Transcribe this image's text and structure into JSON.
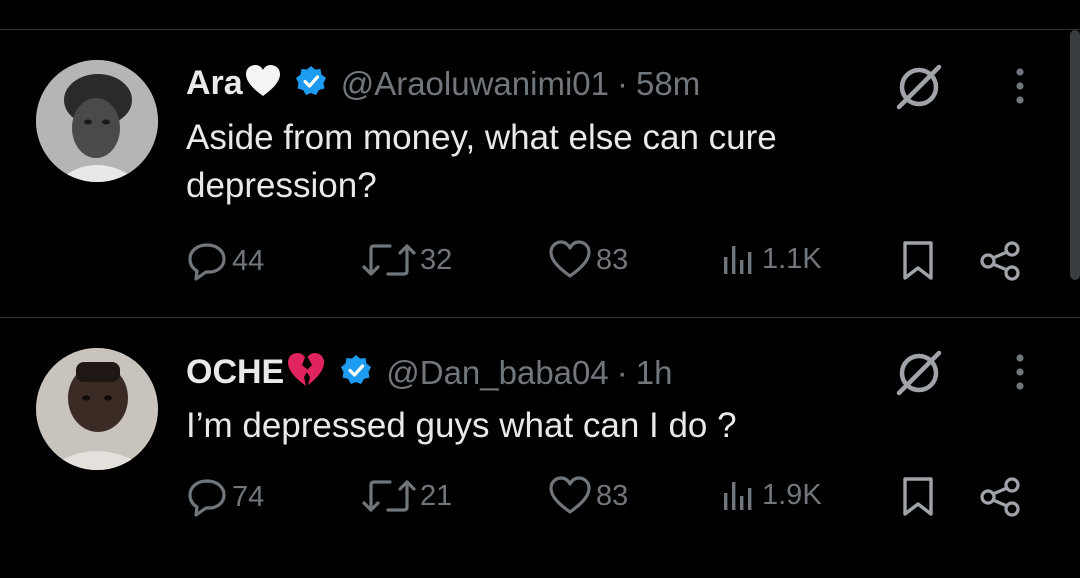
{
  "tweets": [
    {
      "name": "Ara",
      "emoji": "🤍",
      "handle": "@Araoluwanimi01",
      "separator": "·",
      "time": "58m",
      "text": "Aside from money, what else can cure depression?",
      "replies": "44",
      "retweets": "32",
      "likes": "83",
      "views": "1.1K",
      "verified": true
    },
    {
      "name": "OCHE",
      "emoji": "💔",
      "handle": "@Dan_baba04",
      "separator": "·",
      "time": "1h",
      "text": "I’m depressed guys what can I do ?",
      "replies": "74",
      "retweets": "21",
      "likes": "83",
      "views": "1.9K",
      "verified": true
    }
  ],
  "colors": {
    "background": "#000000",
    "text": "#e7e9ea",
    "muted": "#71767b",
    "verified_blue": "#1d9bf0",
    "divider": "#2f3336"
  },
  "icons": [
    "reply-icon",
    "retweet-icon",
    "like-icon",
    "views-icon",
    "bookmark-icon",
    "share-icon",
    "grok-icon",
    "more-icon",
    "verified-badge-icon"
  ]
}
